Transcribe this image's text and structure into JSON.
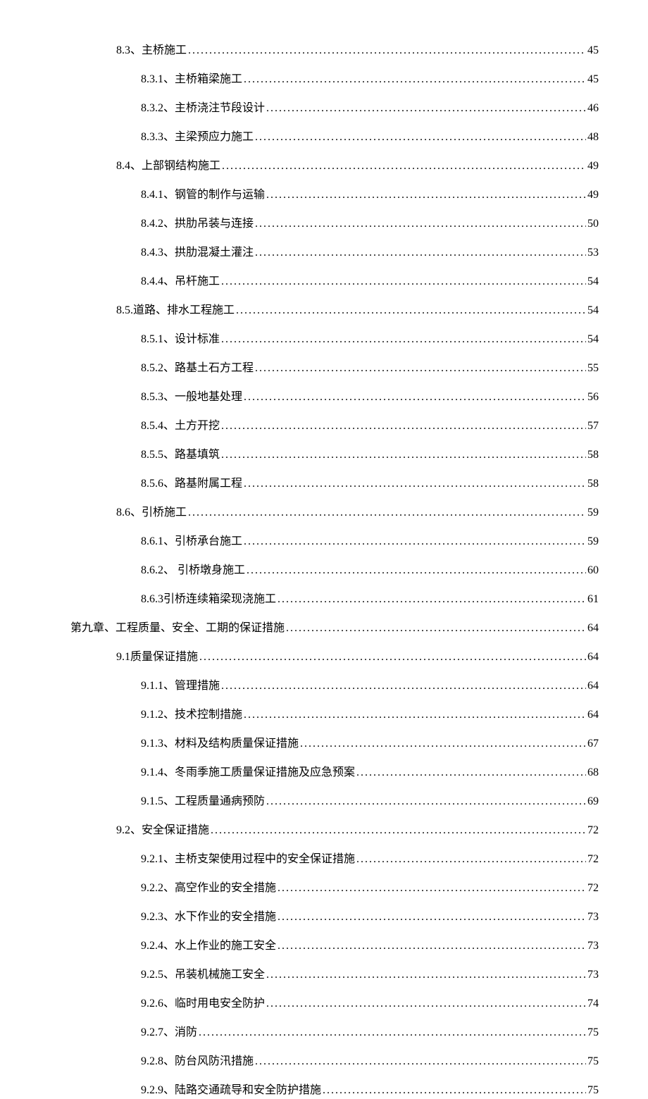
{
  "toc": [
    {
      "level": 2,
      "label": "8.3、主桥施工",
      "page": "45"
    },
    {
      "level": 3,
      "label": "8.3.1、主桥箱梁施工",
      "page": "45"
    },
    {
      "level": 3,
      "label": "8.3.2、主桥浇注节段设计",
      "page": "46"
    },
    {
      "level": 3,
      "label": "8.3.3、主梁预应力施工",
      "page": "48"
    },
    {
      "level": 2,
      "label": "8.4、上部钢结构施工",
      "page": "49"
    },
    {
      "level": 3,
      "label": "8.4.1、钢管的制作与运输",
      "page": "49"
    },
    {
      "level": 3,
      "label": "8.4.2、拱肋吊装与连接",
      "page": "50"
    },
    {
      "level": 3,
      "label": "8.4.3、拱肋混凝土灌注",
      "page": "53"
    },
    {
      "level": 3,
      "label": "8.4.4、吊杆施工",
      "page": "54"
    },
    {
      "level": 2,
      "label": "8.5.道路、排水工程施工",
      "page": "54"
    },
    {
      "level": 3,
      "label": "8.5.1、设计标准",
      "page": "54"
    },
    {
      "level": 3,
      "label": "8.5.2、路基土石方工程",
      "page": "55"
    },
    {
      "level": 3,
      "label": "8.5.3、一般地基处理",
      "page": "56"
    },
    {
      "level": 3,
      "label": "8.5.4、土方开挖",
      "page": "57"
    },
    {
      "level": 3,
      "label": "8.5.5、路基填筑",
      "page": "58"
    },
    {
      "level": 3,
      "label": "8.5.6、路基附属工程",
      "page": "58"
    },
    {
      "level": 2,
      "label": "8.6、引桥施工",
      "page": "59"
    },
    {
      "level": 3,
      "label": "8.6.1、引桥承台施工",
      "page": "59"
    },
    {
      "level": 3,
      "label": "8.6.2、 引桥墩身施工",
      "page": "60"
    },
    {
      "level": 3,
      "label": "8.6.3引桥连续箱梁现浇施工",
      "page": "61"
    },
    {
      "level": 1,
      "label": "第九章、工程质量、安全、工期的保证措施",
      "page": "64"
    },
    {
      "level": 2,
      "label": "9.1质量保证措施",
      "page": "64"
    },
    {
      "level": 3,
      "label": "9.1.1、管理措施",
      "page": "64"
    },
    {
      "level": 3,
      "label": "9.1.2、技术控制措施",
      "page": "64"
    },
    {
      "level": 3,
      "label": "9.1.3、材料及结构质量保证措施",
      "page": "67"
    },
    {
      "level": 3,
      "label": "9.1.4、冬雨季施工质量保证措施及应急预案",
      "page": "68"
    },
    {
      "level": 3,
      "label": "9.1.5、工程质量通病预防",
      "page": "69"
    },
    {
      "level": 2,
      "label": "9.2、安全保证措施",
      "page": "72"
    },
    {
      "level": 3,
      "label": "9.2.1、主桥支架使用过程中的安全保证措施",
      "page": "72"
    },
    {
      "level": 3,
      "label": "9.2.2、高空作业的安全措施",
      "page": "72"
    },
    {
      "level": 3,
      "label": "9.2.3、水下作业的安全措施",
      "page": "73"
    },
    {
      "level": 3,
      "label": "9.2.4、水上作业的施工安全",
      "page": "73"
    },
    {
      "level": 3,
      "label": "9.2.5、吊装机械施工安全",
      "page": "73"
    },
    {
      "level": 3,
      "label": "9.2.6、临时用电安全防护",
      "page": "74"
    },
    {
      "level": 3,
      "label": "9.2.7、消防",
      "page": "75"
    },
    {
      "level": 3,
      "label": "9.2.8、防台风防汛措施",
      "page": "75"
    },
    {
      "level": 3,
      "label": "9.2.9、陆路交通疏导和安全防护措施",
      "page": "75"
    }
  ]
}
